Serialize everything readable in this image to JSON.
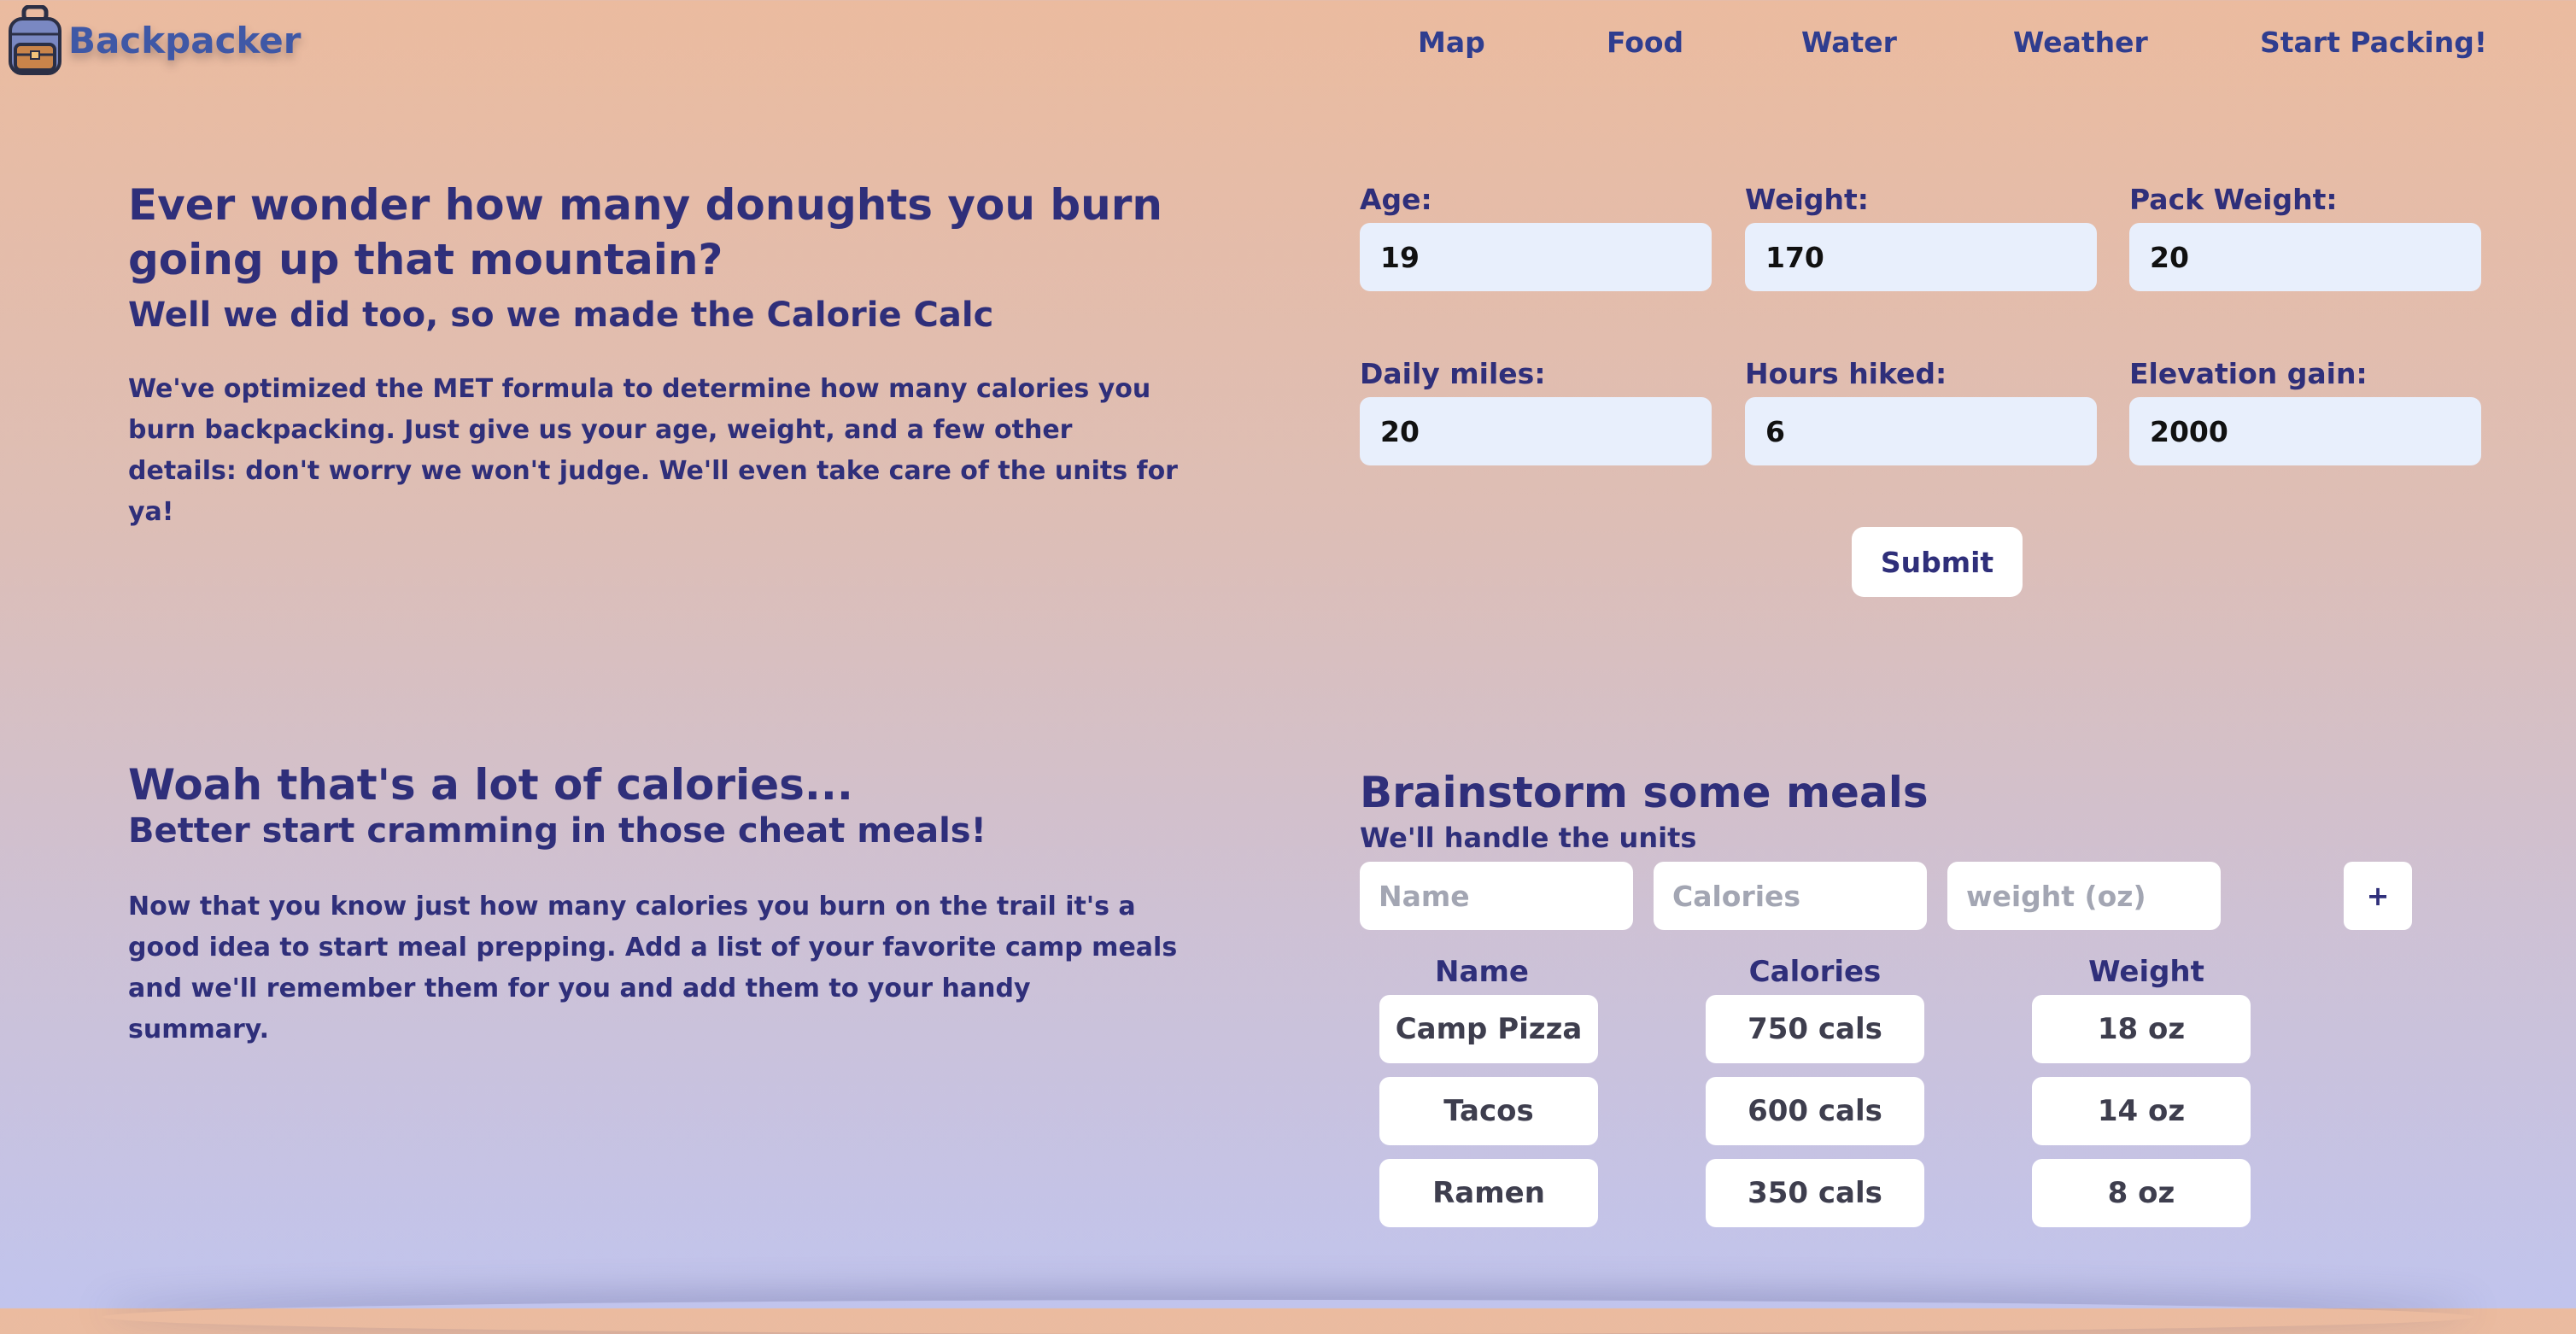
{
  "header": {
    "logo_text": "Backpacker",
    "nav": [
      "Map",
      "Food",
      "Water",
      "Weather",
      "Start Packing!"
    ]
  },
  "intro": {
    "title": "Ever wonder how many donughts you burn going up that mountain?",
    "subtitle": "Well we did too, so we made the Calorie Calc",
    "body": "We've optimized the MET formula to determine how many calories you burn backpacking. Just give us your age, weight, and a few other details: don't worry we won't judge. We'll even take care of the units for ya!"
  },
  "calc_form": {
    "fields": [
      {
        "label": "Age:",
        "value": "19"
      },
      {
        "label": "Weight:",
        "value": "170"
      },
      {
        "label": "Pack Weight:",
        "value": "20"
      },
      {
        "label": "Daily miles:",
        "value": "20"
      },
      {
        "label": "Hours hiked:",
        "value": "6"
      },
      {
        "label": "Elevation gain:",
        "value": "2000"
      }
    ],
    "submit_label": "Submit"
  },
  "meals_intro": {
    "title": "Woah that's a lot of calories...",
    "subtitle": "Better start cramming in those cheat meals!",
    "body": "Now that you know just how many calories you burn on the trail it's a good idea to start meal prepping. Add a list of your favorite camp meals and we'll remember them for you and add them to your handy summary."
  },
  "meals": {
    "title": "Brainstorm some meals",
    "subtitle": "We'll handle the units",
    "placeholders": {
      "name": "Name",
      "calories": "Calories",
      "weight": "weight (oz)"
    },
    "add_label": "+",
    "columns": [
      "Name",
      "Calories",
      "Weight"
    ],
    "rows": [
      {
        "name": "Camp Pizza",
        "calories": "750 cals",
        "weight": "18 oz"
      },
      {
        "name": "Tacos",
        "calories": "600 cals",
        "weight": "14 oz"
      },
      {
        "name": "Ramen",
        "calories": "350 cals",
        "weight": "8 oz"
      }
    ]
  },
  "colors": {
    "accent": "#2f2f7a",
    "logo": "#3f58a6",
    "input_bg": "#e8effc",
    "gradient_top": "#ebbb9f",
    "gradient_bottom": "#c1c4ed"
  },
  "icons": {
    "logo": "backpack-icon"
  }
}
